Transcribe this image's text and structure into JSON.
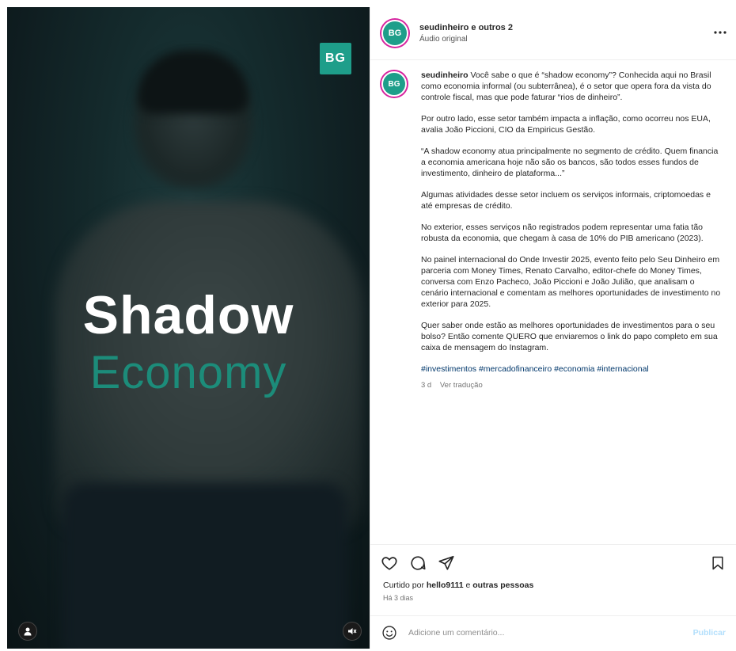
{
  "media": {
    "badge_text": "BG",
    "title_line1": "Shadow",
    "title_line2": "Economy",
    "colors": {
      "title_primary": "#ffffff",
      "title_accent": "#1c8c7a",
      "badge_bg": "#1e9e8a"
    }
  },
  "header": {
    "avatar_text": "BG",
    "username": "seudinheiro e outros 2",
    "subtitle": "Áudio original",
    "more_icon": "more-horizontal-icon"
  },
  "caption": {
    "avatar_text": "BG",
    "username": "seudinheiro",
    "first_paragraph": "Você sabe o que é “shadow economy”? Conhecida aqui no Brasil como economia informal (ou subterrânea), é o setor que opera fora da vista do controle fiscal, mas que pode faturar “rios de dinheiro”.",
    "paragraphs": [
      "Por outro lado, esse setor também impacta a inflação, como ocorreu nos EUA, avalia João Piccioni, CIO da Empiricus Gestão.",
      "“A shadow economy atua principalmente no segmento de crédito. Quem financia a economia americana hoje não são os bancos, são todos esses fundos de investimento, dinheiro de plataforma...”",
      "Algumas atividades desse setor incluem os serviços informais, criptomoedas e até empresas de crédito.",
      "No exterior, esses serviços não registrados podem representar uma fatia tão robusta da economia, que chegam à casa de 10% do PIB americano (2023).",
      "No painel internacional do Onde Investir 2025, evento feito pelo Seu Dinheiro em parceria com Money Times, Renato Carvalho, editor-chefe do Money Times, conversa com Enzo Pacheco, João Piccioni e João Julião, que analisam o cenário internacional e comentam as melhores oportunidades de investimento no exterior para 2025.",
      "Quer saber onde estão as melhores oportunidades de investimentos para o seu bolso? Então comente QUERO que enviaremos o link do papo completo em sua caixa de mensagem do Instagram."
    ],
    "hashtags": "#investimentos #mercadofinanceiro #economia #internacional",
    "time": "3 d",
    "translate": "Ver tradução"
  },
  "actions": {
    "like_icon": "heart-icon",
    "comment_icon": "comment-icon",
    "share_icon": "share-icon",
    "save_icon": "bookmark-icon"
  },
  "likes": {
    "prefix": "Curtido por ",
    "user": "hello9111",
    "suffix": " e ",
    "others": "outras pessoas"
  },
  "time_ago": "Há 3 dias",
  "comment": {
    "emoji_icon": "emoji-icon",
    "placeholder": "Adicione um comentário...",
    "post_label": "Publicar"
  }
}
